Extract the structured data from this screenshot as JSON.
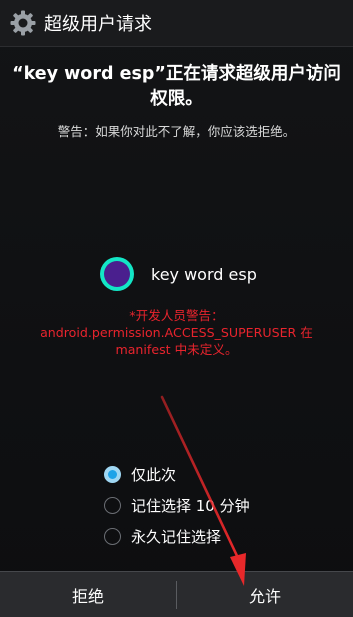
{
  "titlebar": {
    "icon": "gear-icon",
    "title": "超级用户请求"
  },
  "request": {
    "title": "“key word esp”正在请求超级用户访问权限。",
    "warning": "警告：如果你对此不了解，你应该选拒绝。"
  },
  "app": {
    "name": "key word esp",
    "icon": "app-logo-icon"
  },
  "developer_warning": {
    "line1": "*开发人员警告：",
    "line2": "android.permission.ACCESS_SUPERUSER 在",
    "line3": "manifest 中未定义。"
  },
  "options": [
    {
      "label": "仅此次",
      "selected": true
    },
    {
      "label": "记住选择 10 分钟",
      "selected": false
    },
    {
      "label": "永久记住选择",
      "selected": false
    }
  ],
  "buttons": {
    "deny": "拒绝",
    "allow": "允许"
  },
  "colors": {
    "accent": "#1ea3e8",
    "warning_red": "#e8242d",
    "annotation_arrow": "#e8282a"
  }
}
